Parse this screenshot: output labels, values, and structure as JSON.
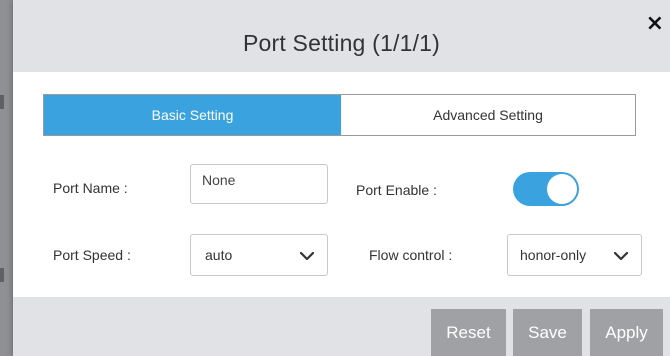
{
  "dialog": {
    "title": "Port Setting (1/1/1)",
    "close_glyph": "×"
  },
  "tabs": [
    {
      "label": "Basic Setting",
      "active": true
    },
    {
      "label": "Advanced Setting",
      "active": false
    }
  ],
  "form": {
    "port_name": {
      "label": "Port Name :",
      "value": "None"
    },
    "port_enable": {
      "label": "Port Enable :",
      "on": true
    },
    "port_speed": {
      "label": "Port Speed :",
      "selected": "auto"
    },
    "flow_control": {
      "label": "Flow control :",
      "selected": "honor-only"
    }
  },
  "buttons": {
    "reset": "Reset",
    "save": "Save",
    "apply": "Apply"
  },
  "colors": {
    "accent": "#3aa2de",
    "header_bg": "#e1e2e6",
    "button_bg": "#a0a1a4"
  }
}
